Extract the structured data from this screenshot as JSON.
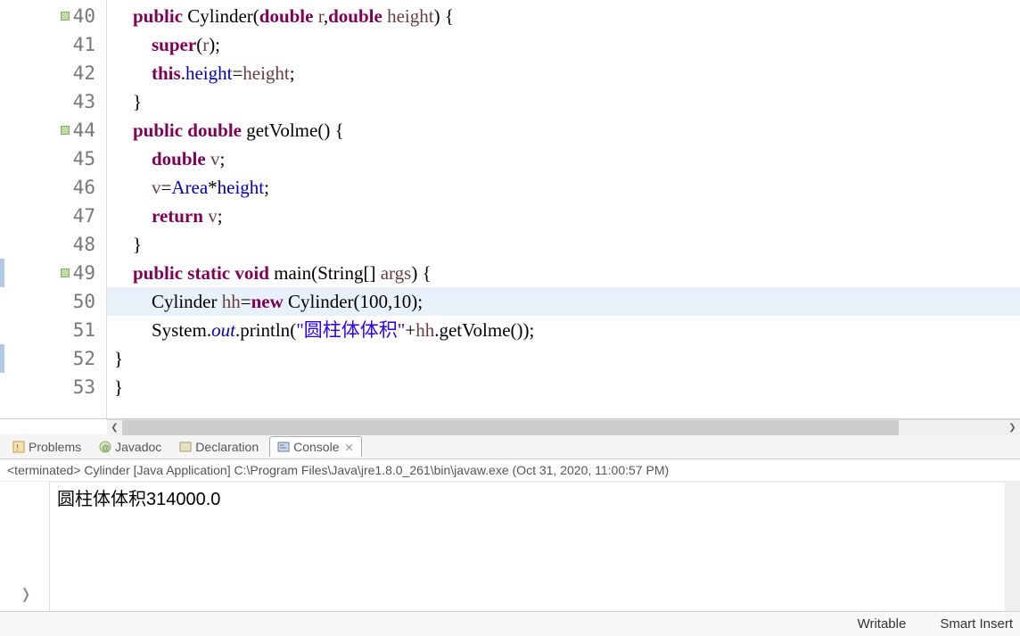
{
  "code": {
    "lines": [
      {
        "num": "40",
        "marker": "override",
        "tokens": [
          {
            "cls": "punct",
            "t": "    "
          },
          {
            "cls": "kw",
            "t": "public"
          },
          {
            "cls": "punct",
            "t": " "
          },
          {
            "cls": "type",
            "t": "Cylinder("
          },
          {
            "cls": "kw",
            "t": "double"
          },
          {
            "cls": "punct",
            "t": " "
          },
          {
            "cls": "param",
            "t": "r"
          },
          {
            "cls": "punct",
            "t": ","
          },
          {
            "cls": "kw",
            "t": "double"
          },
          {
            "cls": "punct",
            "t": " "
          },
          {
            "cls": "param",
            "t": "height"
          },
          {
            "cls": "punct",
            "t": ") {"
          }
        ]
      },
      {
        "num": "41",
        "tokens": [
          {
            "cls": "punct",
            "t": "        "
          },
          {
            "cls": "kw",
            "t": "super"
          },
          {
            "cls": "punct",
            "t": "("
          },
          {
            "cls": "param",
            "t": "r"
          },
          {
            "cls": "punct",
            "t": ");"
          }
        ]
      },
      {
        "num": "42",
        "tokens": [
          {
            "cls": "punct",
            "t": "        "
          },
          {
            "cls": "kw",
            "t": "this"
          },
          {
            "cls": "punct",
            "t": "."
          },
          {
            "cls": "field",
            "t": "height"
          },
          {
            "cls": "punct",
            "t": "="
          },
          {
            "cls": "param",
            "t": "height"
          },
          {
            "cls": "punct",
            "t": ";"
          }
        ]
      },
      {
        "num": "43",
        "tokens": [
          {
            "cls": "punct",
            "t": "    }"
          }
        ]
      },
      {
        "num": "44",
        "marker": "override",
        "tokens": [
          {
            "cls": "punct",
            "t": "    "
          },
          {
            "cls": "kw",
            "t": "public"
          },
          {
            "cls": "punct",
            "t": " "
          },
          {
            "cls": "kw",
            "t": "double"
          },
          {
            "cls": "punct",
            "t": " "
          },
          {
            "cls": "method",
            "t": "getVolme"
          },
          {
            "cls": "punct",
            "t": "() {"
          }
        ]
      },
      {
        "num": "45",
        "tokens": [
          {
            "cls": "punct",
            "t": "        "
          },
          {
            "cls": "kw",
            "t": "double"
          },
          {
            "cls": "punct",
            "t": " "
          },
          {
            "cls": "localvar",
            "t": "v"
          },
          {
            "cls": "punct",
            "t": ";"
          }
        ]
      },
      {
        "num": "46",
        "tokens": [
          {
            "cls": "punct",
            "t": "        "
          },
          {
            "cls": "localvar",
            "t": "v"
          },
          {
            "cls": "punct",
            "t": "="
          },
          {
            "cls": "field",
            "t": "Area"
          },
          {
            "cls": "punct",
            "t": "*"
          },
          {
            "cls": "field",
            "t": "height"
          },
          {
            "cls": "punct",
            "t": ";"
          }
        ]
      },
      {
        "num": "47",
        "tokens": [
          {
            "cls": "punct",
            "t": "        "
          },
          {
            "cls": "kw",
            "t": "return"
          },
          {
            "cls": "punct",
            "t": " "
          },
          {
            "cls": "localvar",
            "t": "v"
          },
          {
            "cls": "punct",
            "t": ";"
          }
        ]
      },
      {
        "num": "48",
        "tokens": [
          {
            "cls": "punct",
            "t": "    }"
          }
        ]
      },
      {
        "num": "49",
        "quickdiff": true,
        "marker": "override",
        "tokens": [
          {
            "cls": "punct",
            "t": "    "
          },
          {
            "cls": "kw",
            "t": "public"
          },
          {
            "cls": "punct",
            "t": " "
          },
          {
            "cls": "kw",
            "t": "static"
          },
          {
            "cls": "punct",
            "t": " "
          },
          {
            "cls": "kw",
            "t": "void"
          },
          {
            "cls": "punct",
            "t": " "
          },
          {
            "cls": "method",
            "t": "main"
          },
          {
            "cls": "punct",
            "t": "("
          },
          {
            "cls": "type",
            "t": "String"
          },
          {
            "cls": "punct",
            "t": "[] "
          },
          {
            "cls": "param",
            "t": "args"
          },
          {
            "cls": "punct",
            "t": ") {"
          }
        ]
      },
      {
        "num": "50",
        "highlight": true,
        "tokens": [
          {
            "cls": "punct",
            "t": "        "
          },
          {
            "cls": "type",
            "t": "Cylinder "
          },
          {
            "cls": "localvar",
            "t": "hh"
          },
          {
            "cls": "punct",
            "t": "="
          },
          {
            "cls": "kw",
            "t": "new"
          },
          {
            "cls": "punct",
            "t": " "
          },
          {
            "cls": "type",
            "t": "Cylinder("
          },
          {
            "cls": "num",
            "t": "100"
          },
          {
            "cls": "punct",
            "t": ","
          },
          {
            "cls": "num",
            "t": "10"
          },
          {
            "cls": "punct",
            "t": ");"
          }
        ]
      },
      {
        "num": "51",
        "tokens": [
          {
            "cls": "punct",
            "t": "        "
          },
          {
            "cls": "type",
            "t": "System"
          },
          {
            "cls": "punct",
            "t": "."
          },
          {
            "cls": "staticfield",
            "t": "out"
          },
          {
            "cls": "punct",
            "t": "."
          },
          {
            "cls": "method",
            "t": "println"
          },
          {
            "cls": "punct",
            "t": "("
          },
          {
            "cls": "str",
            "t": "\"圆柱体体积\""
          },
          {
            "cls": "punct",
            "t": "+"
          },
          {
            "cls": "localvar",
            "t": "hh"
          },
          {
            "cls": "punct",
            "t": "."
          },
          {
            "cls": "method",
            "t": "getVolme"
          },
          {
            "cls": "punct",
            "t": "());"
          }
        ]
      },
      {
        "num": "52",
        "quickdiff": true,
        "tokens": [
          {
            "cls": "punct",
            "t": "}"
          }
        ]
      },
      {
        "num": "53",
        "tokens": [
          {
            "cls": "punct",
            "t": "}"
          }
        ]
      }
    ]
  },
  "tabs": {
    "problems": "Problems",
    "javadoc": "Javadoc",
    "declaration": "Declaration",
    "console": "Console"
  },
  "console": {
    "header": "<terminated> Cylinder [Java Application] C:\\Program Files\\Java\\jre1.8.0_261\\bin\\javaw.exe (Oct 31, 2020, 11:00:57 PM)",
    "output": "圆柱体体积314000.0"
  },
  "status": {
    "writable": "Writable",
    "insert": "Smart Insert"
  },
  "glyphs": {
    "chevron_left": "❮",
    "chevron_right": "❯",
    "close": "⨯",
    "show_view": "❭"
  }
}
